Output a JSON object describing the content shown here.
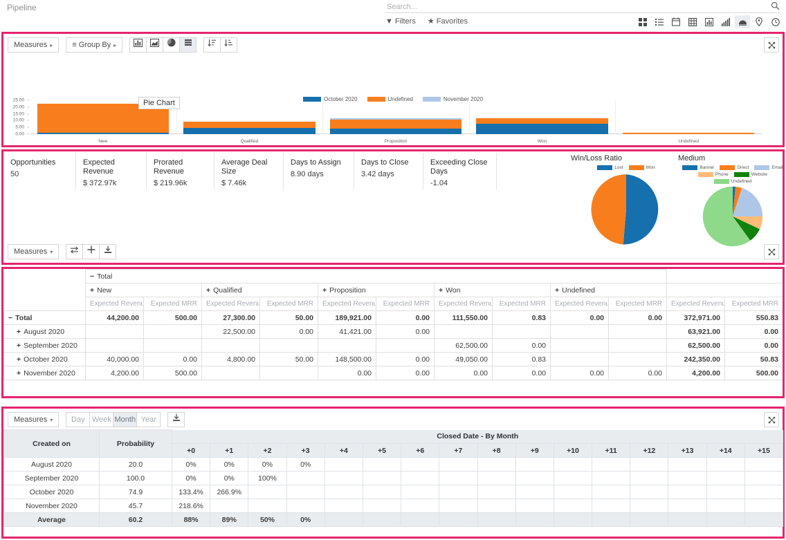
{
  "header": {
    "breadcrumb": "Pipeline",
    "search_placeholder": "Search...",
    "search_value": "",
    "filters_label": "Filters",
    "favorites_label": "Favorites",
    "view_icons": [
      {
        "name": "kanban-view-icon",
        "active": false
      },
      {
        "name": "list-view-icon",
        "active": false
      },
      {
        "name": "calendar-view-icon",
        "active": false
      },
      {
        "name": "pivot-view-icon",
        "active": false
      },
      {
        "name": "bar-chart-view-icon",
        "active": false
      },
      {
        "name": "activity-view-icon",
        "active": false
      },
      {
        "name": "cohort-view-icon",
        "active": true
      },
      {
        "name": "map-view-icon",
        "active": false
      },
      {
        "name": "clock-view-icon",
        "active": false
      }
    ]
  },
  "chart_panel": {
    "measures_label": "Measures",
    "group_by_label": "Group By",
    "tooltip": "Pie Chart",
    "buttons": [
      {
        "name": "bar-chart-button",
        "glyph": "bar",
        "active": false
      },
      {
        "name": "line-chart-button",
        "glyph": "line",
        "active": false
      },
      {
        "name": "pie-chart-button",
        "glyph": "pie",
        "active": false
      },
      {
        "name": "stacked-button",
        "glyph": "stack",
        "active": true
      },
      {
        "name": "sort-desc-button",
        "glyph": "sortdesc",
        "active": false
      },
      {
        "name": "sort-asc-button",
        "glyph": "sortasc",
        "active": false
      }
    ]
  },
  "chart_data": {
    "type": "bar",
    "title": "",
    "xlabel": "",
    "ylabel": "",
    "stacked": true,
    "ylim": [
      0,
      25
    ],
    "yticks": [
      "0.00",
      "5.00",
      "10.00",
      "15.00",
      "20.00",
      "25.00"
    ],
    "categories": [
      "New",
      "Qualified",
      "Proposition",
      "Won",
      "Undefined"
    ],
    "legend_position": "top",
    "series": [
      {
        "name": "October 2020",
        "color": "#1570ad",
        "values": [
          0.8,
          4.5,
          4.0,
          7.5,
          0
        ]
      },
      {
        "name": "Undefined",
        "color": "#f87e1d",
        "values": [
          21.7,
          4.5,
          6.5,
          4.5,
          1.0
        ]
      },
      {
        "name": "November 2020",
        "color": "#aec7e8",
        "values": [
          0,
          0,
          1.0,
          0,
          0
        ]
      }
    ]
  },
  "kpis": [
    {
      "label": "Opportunities",
      "value": "50"
    },
    {
      "label": "Expected Revenue",
      "value": "$ 372.97k"
    },
    {
      "label": "Prorated Revenue",
      "value": "$ 219.96k"
    },
    {
      "label": "Average Deal Size",
      "value": "$ 7.46k"
    },
    {
      "label": "Days to Assign",
      "value": "8.90 days"
    },
    {
      "label": "Days to Close",
      "value": "3.42 days"
    },
    {
      "label": "Exceeding Close Days",
      "value": "-1.04"
    }
  ],
  "pie_charts": [
    {
      "type": "pie",
      "title": "Win/Loss Ratio",
      "labels": [
        "Lost",
        "Won"
      ],
      "values": [
        48,
        52
      ],
      "colors": [
        "#1570ad",
        "#f87e1d"
      ]
    },
    {
      "type": "pie",
      "title": "Medium",
      "labels": [
        "Banner",
        "Direct",
        "Email",
        "Phone",
        "Website",
        "Undefined"
      ],
      "values": [
        1.5,
        3.5,
        20,
        7,
        8,
        60
      ],
      "colors": [
        "#1570ad",
        "#f87e1d",
        "#aec7e8",
        "#ffbb78",
        "#11820d",
        "#8fd98a"
      ]
    }
  ],
  "pivot_toolbar": {
    "measures_label": "Measures",
    "flip_icon": "flip-axis-icon",
    "expand_icon": "expand-all-icon",
    "download_icon": "download-xlsx-icon"
  },
  "pivot": {
    "total_header": "Total",
    "col_groups": [
      "New",
      "Qualified",
      "Proposition",
      "Won",
      "Undefined"
    ],
    "total_col_group": "",
    "measures": [
      "Expected Revenue",
      "Expected MRR"
    ],
    "rows": [
      {
        "label": "Total",
        "icon": "minus",
        "is_total": true,
        "cells": [
          "44,200.00",
          "500.00",
          "27,300.00",
          "50.00",
          "189,921.00",
          "0.00",
          "111,550.00",
          "0.83",
          "0.00",
          "0.00",
          "372,971.00",
          "550.83"
        ]
      },
      {
        "label": "August 2020",
        "icon": "plus",
        "is_total": false,
        "cells": [
          "",
          "",
          "22,500.00",
          "0.00",
          "41,421.00",
          "0.00",
          "",
          "",
          "",
          "",
          "63,921.00",
          "0.00"
        ]
      },
      {
        "label": "September 2020",
        "icon": "plus",
        "is_total": false,
        "cells": [
          "",
          "",
          "",
          "",
          "",
          "",
          "62,500.00",
          "0.00",
          "",
          "",
          "62,500.00",
          "0.00"
        ]
      },
      {
        "label": "October 2020",
        "icon": "plus",
        "is_total": false,
        "cells": [
          "40,000.00",
          "0.00",
          "4,800.00",
          "50.00",
          "148,500.00",
          "0.00",
          "49,050.00",
          "0.83",
          "",
          "",
          "242,350.00",
          "50.83"
        ]
      },
      {
        "label": "November 2020",
        "icon": "plus",
        "is_total": false,
        "cells": [
          "4,200.00",
          "500.00",
          "",
          "",
          "0.00",
          "0.00",
          "0.00",
          "0.00",
          "0.00",
          "0.00",
          "4,200.00",
          "500.00"
        ]
      }
    ]
  },
  "cohort": {
    "measures_label": "Measures",
    "intervals": [
      {
        "label": "Day",
        "active": false
      },
      {
        "label": "Week",
        "active": false
      },
      {
        "label": "Month",
        "active": true
      },
      {
        "label": "Year",
        "active": false
      }
    ],
    "download_icon": "download-xlsx-icon",
    "row_header": "Created on",
    "measure_header": "Probability",
    "span_header": "Closed Date - By Month",
    "columns": [
      "+0",
      "+1",
      "+2",
      "+3",
      "+4",
      "+5",
      "+6",
      "+7",
      "+8",
      "+9",
      "+10",
      "+11",
      "+12",
      "+13",
      "+14",
      "+15"
    ],
    "rows": [
      {
        "label": "August 2020",
        "measure": "20.0",
        "values": [
          "0%",
          "0%",
          "0%",
          "0%",
          "",
          "",
          "",
          "",
          "",
          "",
          "",
          "",
          "",
          "",
          "",
          ""
        ]
      },
      {
        "label": "September 2020",
        "measure": "100.0",
        "values": [
          "0%",
          "0%",
          "100%",
          "",
          "",
          "",
          "",
          "",
          "",
          "",
          "",
          "",
          "",
          "",
          "",
          ""
        ]
      },
      {
        "label": "October 2020",
        "measure": "74.9",
        "values": [
          "133.4%",
          "266.9%",
          "",
          "",
          "",
          "",
          "",
          "",
          "",
          "",
          "",
          "",
          "",
          "",
          "",
          ""
        ]
      },
      {
        "label": "November 2020",
        "measure": "45.7",
        "values": [
          "218.6%",
          "",
          "",
          "",
          "",
          "",
          "",
          "",
          "",
          "",
          "",
          "",
          "",
          "",
          "",
          ""
        ]
      }
    ],
    "footer": {
      "label": "Average",
      "measure": "60.2",
      "values": [
        "88%",
        "89%",
        "50%",
        "0%",
        "",
        "",
        "",
        "",
        "",
        "",
        "",
        "",
        "",
        "",
        "",
        ""
      ]
    }
  },
  "colors": {
    "accent_pink": "#e6246e",
    "blue": "#1570ad",
    "orange": "#f87e1d",
    "light_blue": "#aec7e8",
    "light_orange": "#ffbb78",
    "dark_green": "#11820d",
    "light_green": "#8fd98a"
  }
}
